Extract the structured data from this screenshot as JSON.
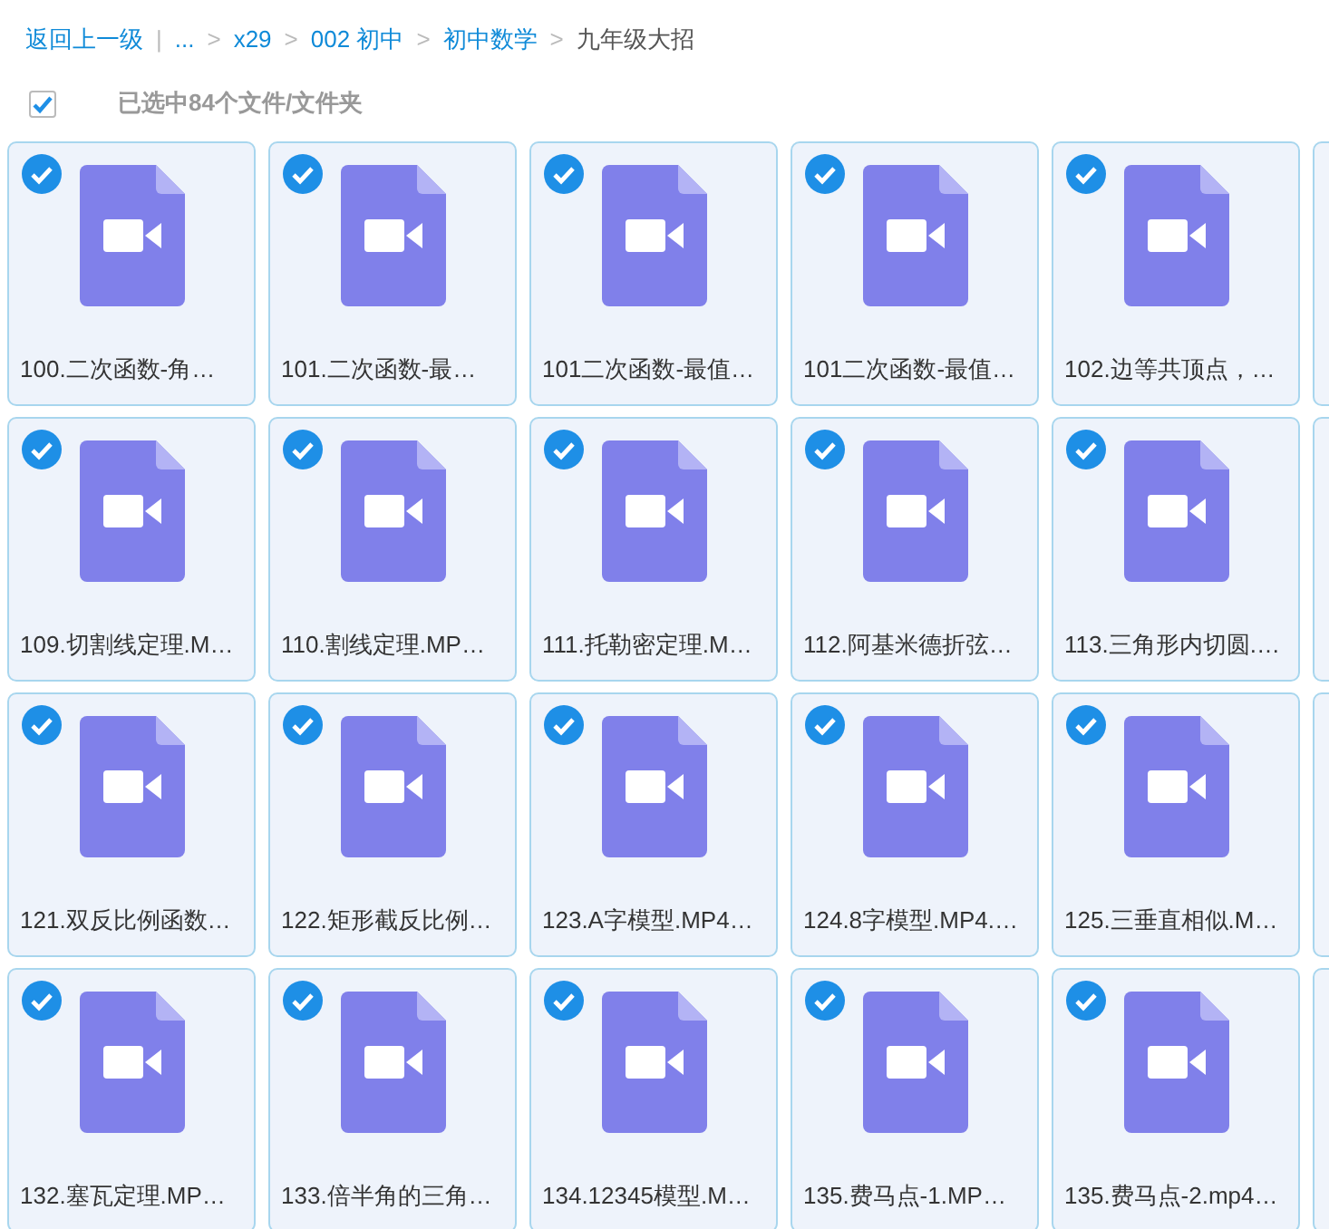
{
  "breadcrumb": [
    {
      "kind": "back",
      "text": "返回上一级"
    },
    {
      "kind": "divider",
      "text": "|"
    },
    {
      "kind": "link",
      "text": "..."
    },
    {
      "kind": "sep",
      "text": ">"
    },
    {
      "kind": "link",
      "text": "x29"
    },
    {
      "kind": "sep",
      "text": ">"
    },
    {
      "kind": "link",
      "text": "002 初中"
    },
    {
      "kind": "sep",
      "text": ">"
    },
    {
      "kind": "link",
      "text": "初中数学"
    },
    {
      "kind": "sep",
      "text": ">"
    },
    {
      "kind": "current",
      "text": "九年级大招"
    }
  ],
  "selection": {
    "checked": true,
    "text": "已选中84个文件/文件夹"
  },
  "files": [
    {
      "name": "100.二次函数-角…",
      "selected": true
    },
    {
      "name": "101.二次函数-最…",
      "selected": true
    },
    {
      "name": "101二次函数-最值…",
      "selected": true
    },
    {
      "name": "101二次函数-最值…",
      "selected": true
    },
    {
      "name": "102.边等共顶点，…",
      "selected": true
    },
    {
      "name": "109.切割线定理.M…",
      "selected": true
    },
    {
      "name": "110.割线定理.MP…",
      "selected": true
    },
    {
      "name": "111.托勒密定理.M…",
      "selected": true
    },
    {
      "name": "112.阿基米德折弦…",
      "selected": true
    },
    {
      "name": "113.三角形内切圆.…",
      "selected": true
    },
    {
      "name": "121.双反比例函数…",
      "selected": true
    },
    {
      "name": "122.矩形截反比例…",
      "selected": true
    },
    {
      "name": "123.A字模型.MP4…",
      "selected": true
    },
    {
      "name": "124.8字模型.MP4.…",
      "selected": true
    },
    {
      "name": "125.三垂直相似.M…",
      "selected": true
    },
    {
      "name": "132.塞瓦定理.MP…",
      "selected": true
    },
    {
      "name": "133.倍半角的三角…",
      "selected": true
    },
    {
      "name": "134.12345模型.M…",
      "selected": true
    },
    {
      "name": "135.费马点-1.MP…",
      "selected": true
    },
    {
      "name": "135.费马点-2.mp4…",
      "selected": true
    }
  ]
}
